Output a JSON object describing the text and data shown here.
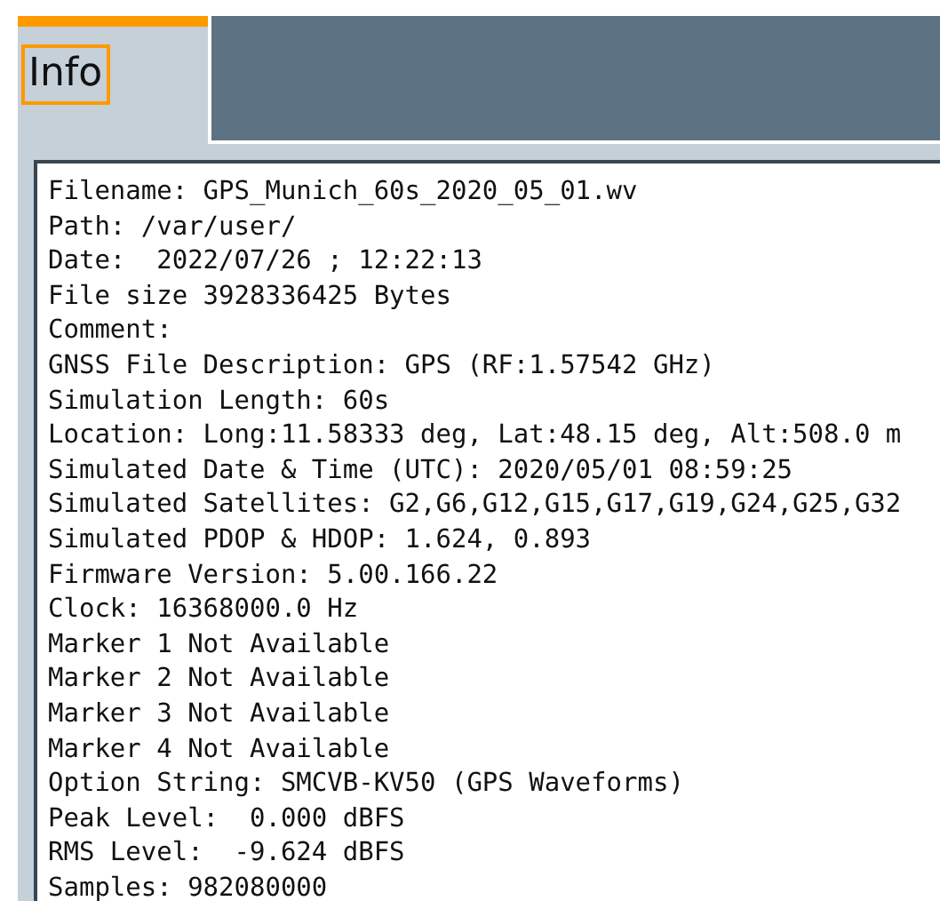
{
  "tabs": [
    {
      "label": "Info",
      "selected": true
    }
  ],
  "info_lines": [
    "Filename: GPS_Munich_60s_2020_05_01.wv",
    "Path: /var/user/",
    "Date:  2022/07/26 ; 12:22:13",
    "File size 3928336425 Bytes",
    "Comment:",
    "GNSS File Description: GPS (RF:1.57542 GHz)",
    "Simulation Length: 60s",
    "Location: Long:11.58333 deg, Lat:48.15 deg, Alt:508.0 m",
    "Simulated Date & Time (UTC): 2020/05/01 08:59:25",
    "Simulated Satellites: G2,G6,G12,G15,G17,G19,G24,G25,G32",
    "Simulated PDOP & HDOP: 1.624, 0.893",
    "Firmware Version: 5.00.166.22",
    "Clock: 16368000.0 Hz",
    "Marker 1 Not Available",
    "Marker 2 Not Available",
    "Marker 3 Not Available",
    "Marker 4 Not Available",
    "Option String: SMCVB-KV50 (GPS Waveforms)",
    "Peak Level:  0.000 dBFS",
    "RMS Level:  -9.624 dBFS",
    "Samples: 982080000"
  ]
}
